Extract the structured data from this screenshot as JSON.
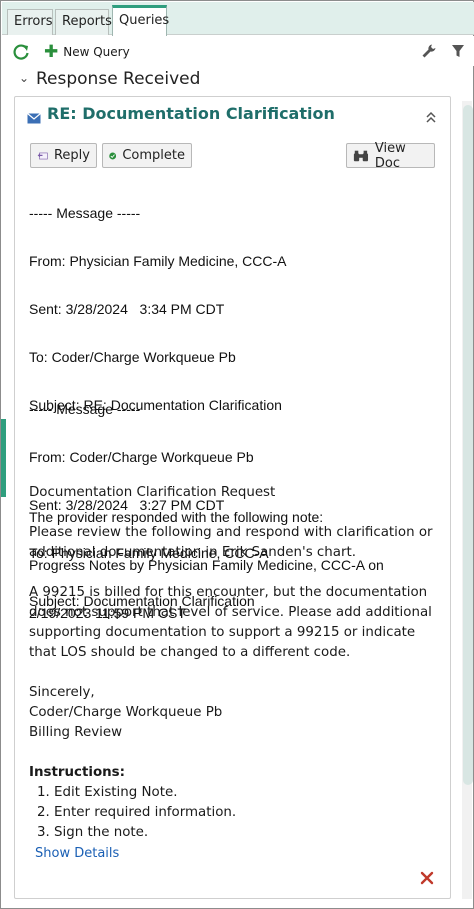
{
  "tabs": [
    {
      "label": "Errors",
      "active": false
    },
    {
      "label": "Reports",
      "active": false
    },
    {
      "label": "Queries",
      "active": true
    }
  ],
  "toolbar": {
    "refresh_icon": "refresh-icon",
    "new_query_label": "New Query",
    "wrench_icon": "wrench-icon",
    "filter_icon": "filter-icon"
  },
  "section": {
    "title": "Response Received",
    "expanded": true
  },
  "card": {
    "title": "RE: Documentation Clarification",
    "buttons": {
      "reply": "Reply",
      "complete": "Complete",
      "view_doc": "View Doc"
    },
    "message1": {
      "header": "----- Message -----",
      "from": "From: Physician Family Medicine, CCC-A",
      "sent": "Sent: 3/28/2024   3:34 PM CDT",
      "to": "To: Coder/Charge Workqueue Pb",
      "subject": "Subject: RE: Documentation Clarification",
      "body_line1": "The provider responded with the following note:",
      "body_line2": "Progress Notes by Physician Family Medicine, CCC-A on",
      "body_line3": "2/19/2023 11:59 PM CST"
    },
    "message2": {
      "header": "----- Message -----",
      "from": "From: Coder/Charge Workqueue Pb",
      "sent": "Sent: 3/28/2024   3:27 PM CDT",
      "to": "To: Physician Family Medicine, CCC-A",
      "subject": "Subject: Documentation Clarification"
    },
    "request": {
      "title": "Documentation Clarification Request",
      "para1": "Please review the following and respond with clarification or additional documentation in Erik Sanden's chart.",
      "para2": "A 99215 is billed for this encounter, but the documentation does not support that level of service. Please add additional supporting documentation to support a 99215 or indicate that LOS should be changed to a different code.",
      "sign1": "Sincerely,",
      "sign2": "Coder/Charge Workqueue Pb",
      "sign3": "Billing Review"
    },
    "instructions": {
      "title": "Instructions:",
      "items": [
        "1. Edit Existing Note.",
        "2. Enter required information.",
        "3. Sign the note."
      ]
    },
    "show_details": "Show Details"
  },
  "colors": {
    "accent": "#2f9e7e",
    "title_teal": "#1f6e6a",
    "link_blue": "#1a5fb4",
    "close_red": "#c0392b"
  }
}
